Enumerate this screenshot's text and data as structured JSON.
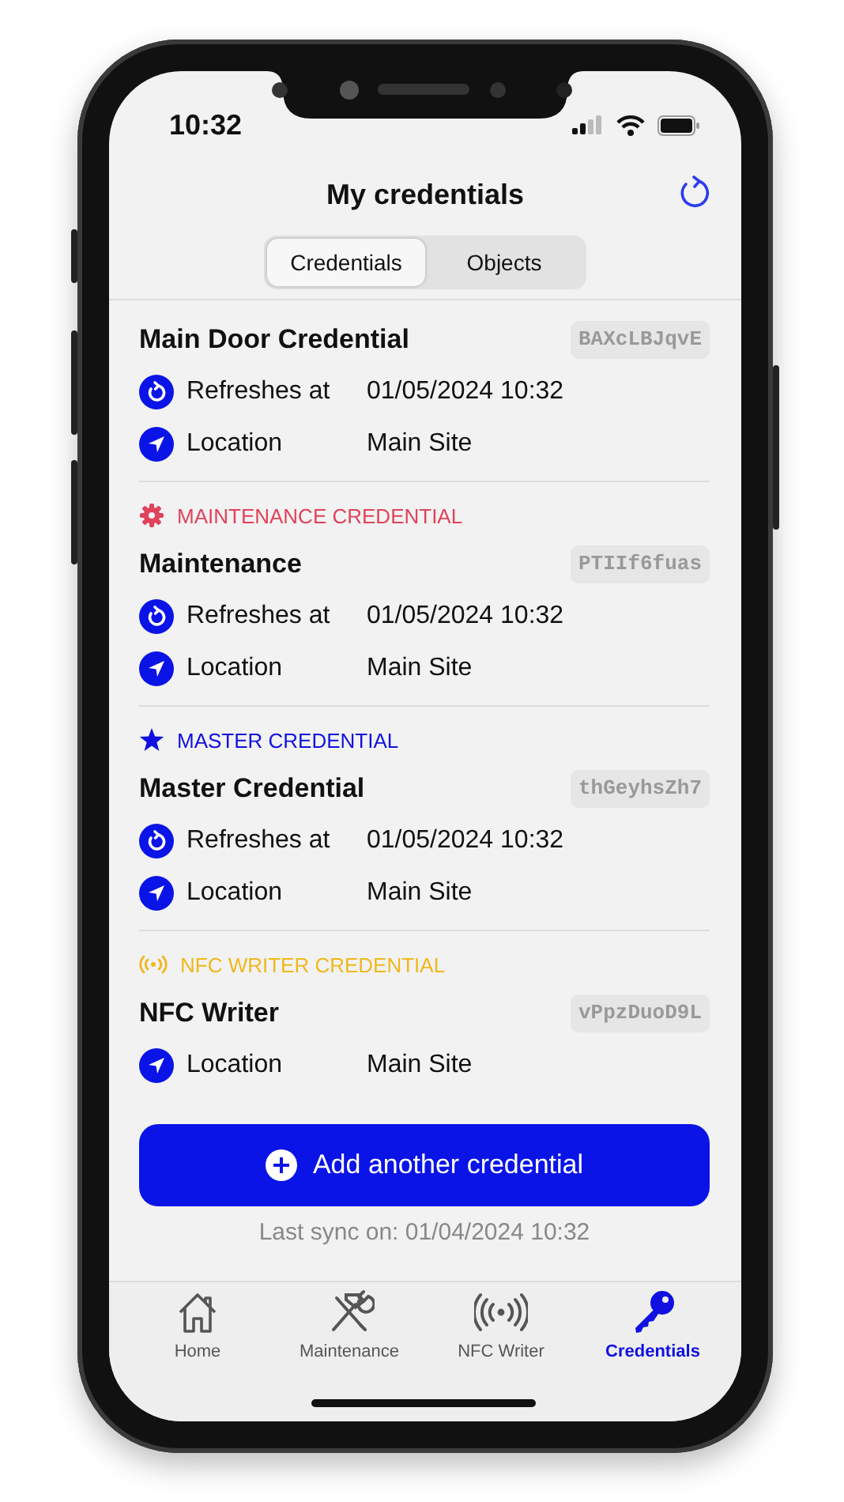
{
  "status_bar": {
    "time": "10:32"
  },
  "header": {
    "title": "My credentials"
  },
  "segments": [
    {
      "label": "Credentials",
      "selected": true
    },
    {
      "label": "Objects",
      "selected": false
    }
  ],
  "credentials": [
    {
      "title": "Main Door Credential",
      "code": "BAXcLBJqvE",
      "rows": [
        {
          "kind": "refresh",
          "label": "Refreshes at",
          "value": "01/05/2024 10:32"
        },
        {
          "kind": "location",
          "label": "Location",
          "value": "Main Site"
        }
      ]
    },
    {
      "category": {
        "kind": "gear",
        "label": "MAINTENANCE CREDENTIAL",
        "color": "#e0435a"
      },
      "title": "Maintenance",
      "code": "PTIIf6fuas",
      "rows": [
        {
          "kind": "refresh",
          "label": "Refreshes at",
          "value": "01/05/2024 10:32"
        },
        {
          "kind": "location",
          "label": "Location",
          "value": "Main Site"
        }
      ]
    },
    {
      "category": {
        "kind": "star",
        "label": "MASTER CREDENTIAL",
        "color": "#1010e0"
      },
      "title": "Master Credential",
      "code": "thGeyhsZh7",
      "rows": [
        {
          "kind": "refresh",
          "label": "Refreshes at",
          "value": "01/05/2024 10:32"
        },
        {
          "kind": "location",
          "label": "Location",
          "value": "Main Site"
        }
      ]
    },
    {
      "category": {
        "kind": "nfc",
        "label": "NFC WRITER CREDENTIAL",
        "color": "#f0b81c"
      },
      "title": "NFC Writer",
      "code": "vPpzDuoD9L",
      "rows": [
        {
          "kind": "location",
          "label": "Location",
          "value": "Main Site"
        }
      ]
    }
  ],
  "add_button": {
    "label": "Add another credential"
  },
  "last_sync": "Last sync on: 01/04/2024 10:32",
  "tab_bar": [
    {
      "kind": "home",
      "label": "Home",
      "selected": false
    },
    {
      "kind": "tools",
      "label": "Maintenance",
      "selected": false
    },
    {
      "kind": "nfc",
      "label": "NFC Writer",
      "selected": false
    },
    {
      "kind": "key",
      "label": "Credentials",
      "selected": true
    }
  ]
}
